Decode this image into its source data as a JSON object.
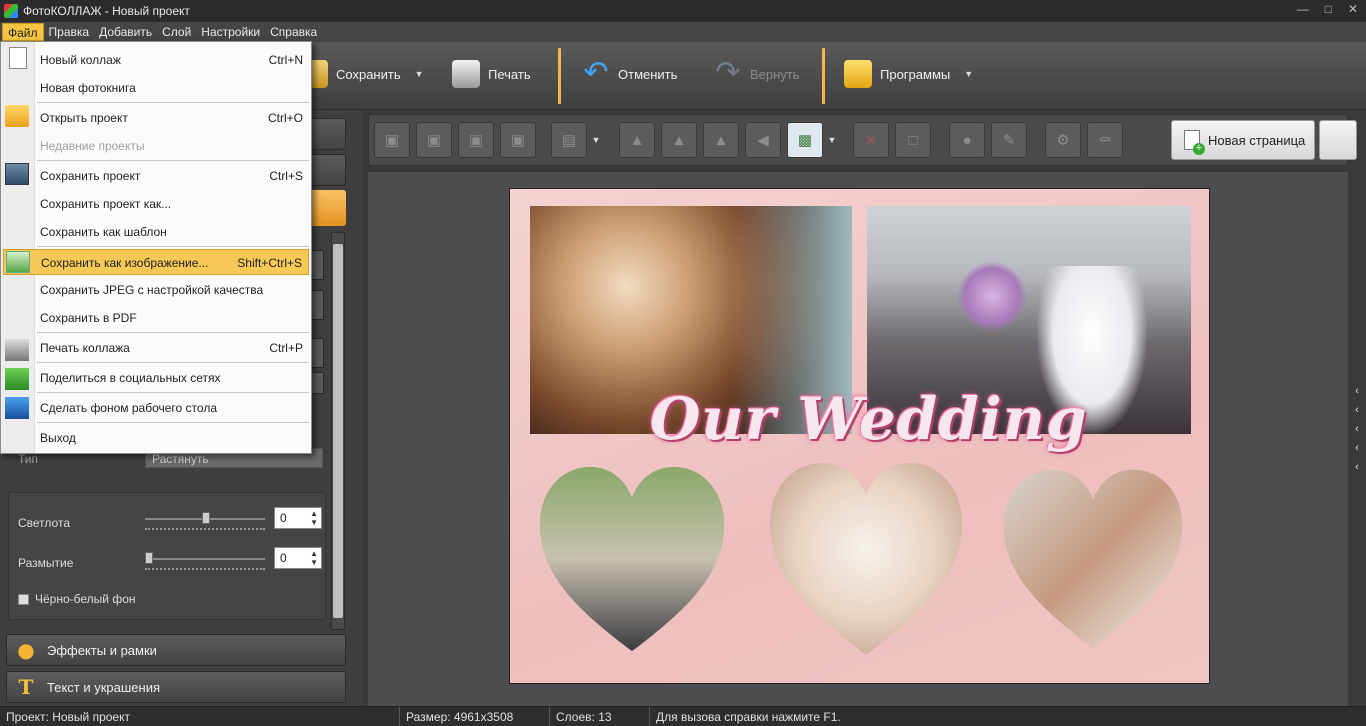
{
  "window": {
    "title": "ФотоКОЛЛАЖ - Новый проект"
  },
  "menubar": {
    "items": [
      "Файл",
      "Правка",
      "Добавить",
      "Слой",
      "Настройки",
      "Справка"
    ]
  },
  "file_menu": [
    {
      "label": "Новый коллаж",
      "shortcut": "Ctrl+N"
    },
    {
      "label": "Новая фотокнига",
      "shortcut": ""
    },
    {
      "label": "Открыть проект",
      "shortcut": "Ctrl+O"
    },
    {
      "label": "Недавние проекты",
      "shortcut": "",
      "disabled": true
    },
    {
      "label": "Сохранить проект",
      "shortcut": "Ctrl+S"
    },
    {
      "label": "Сохранить проект как...",
      "shortcut": ""
    },
    {
      "label": "Сохранить как шаблон",
      "shortcut": ""
    },
    {
      "label": "Сохранить как изображение...",
      "shortcut": "Shift+Ctrl+S",
      "highlighted": true
    },
    {
      "label": "Сохранить JPEG с настройкой качества",
      "shortcut": ""
    },
    {
      "label": "Сохранить в PDF",
      "shortcut": ""
    },
    {
      "label": "Печать коллажа",
      "shortcut": "Ctrl+P"
    },
    {
      "label": "Поделиться в социальных сетях",
      "shortcut": ""
    },
    {
      "label": "Сделать фоном рабочего стола",
      "shortcut": ""
    },
    {
      "label": "Выход",
      "shortcut": ""
    }
  ],
  "toolbar": {
    "save_label": "Сохранить",
    "print_label": "Печать",
    "undo_label": "Отменить",
    "redo_label": "Вернуть",
    "programs_label": "Программы"
  },
  "left_panel": {
    "type_label": "Тип",
    "type_value": "Растянуть",
    "brightness_label": "Светлота",
    "brightness_value": "0",
    "blur_label": "Размытие",
    "blur_value": "0",
    "bw_label": "Чёрно-белый фон",
    "effects_label": "Эффекты и рамки",
    "text_label": "Текст и украшения"
  },
  "workspace": {
    "new_page_label": "Новая страница",
    "collage_title": "Our Wedding"
  },
  "statusbar": {
    "project": "Проект:  Новый проект",
    "size": "Размер:  4961x3508",
    "layers": "Слоев:  13",
    "help": "Для вызова справки нажмите F1."
  },
  "colors": {
    "accent": "#f5c542",
    "toolbar_separator": "#f1b94a",
    "menu_highlight": "#f6c957"
  }
}
